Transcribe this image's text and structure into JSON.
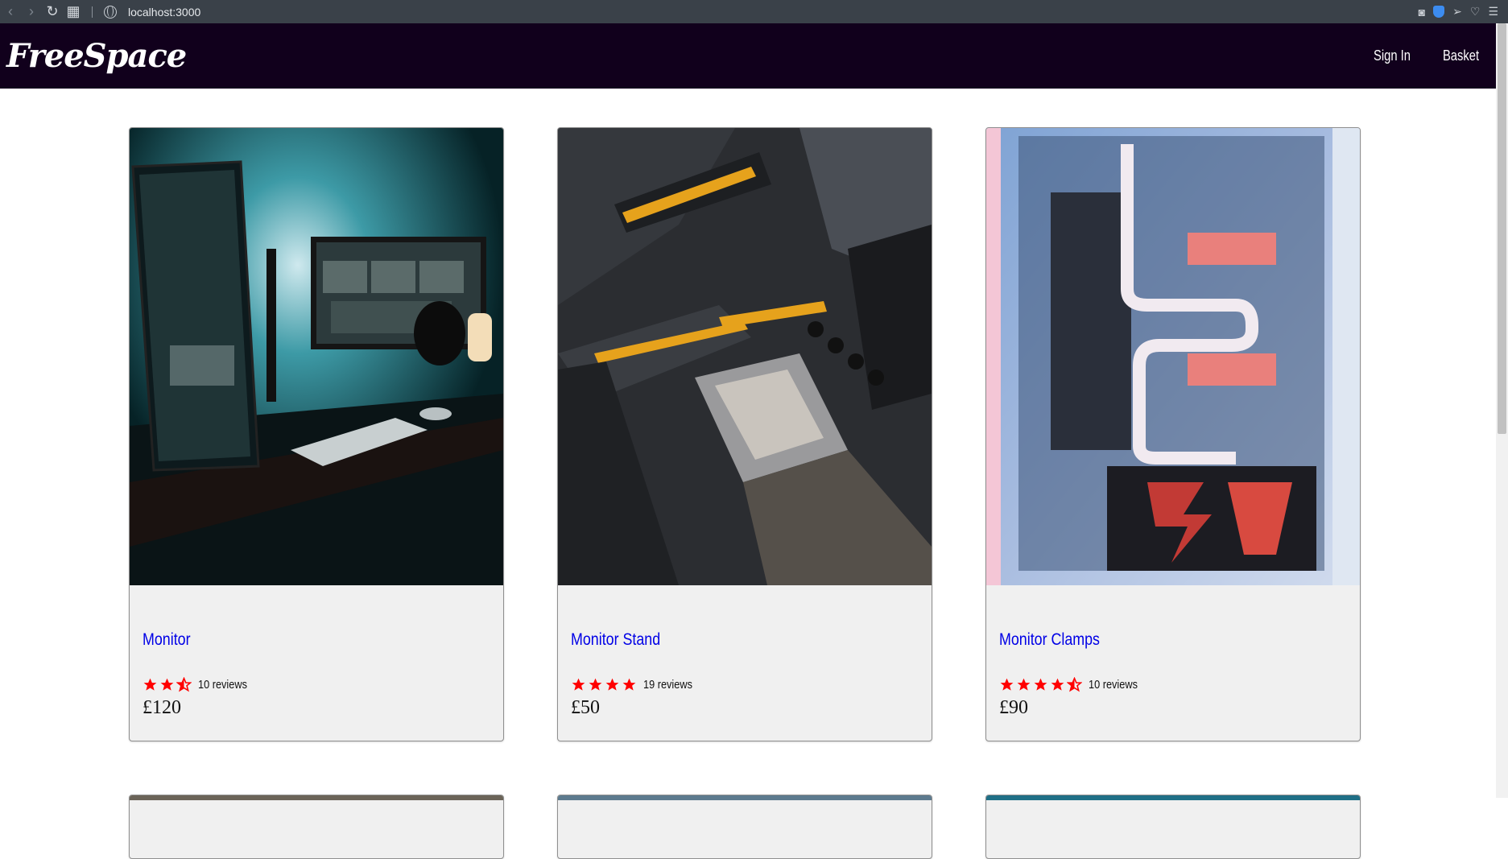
{
  "browser": {
    "url": "localhost:3000",
    "icons": [
      "back-icon",
      "forward-icon",
      "reload-icon",
      "tabs-grid-icon",
      "globe-icon",
      "camera-icon",
      "shield-icon",
      "send-icon",
      "heart-icon",
      "menu-icon"
    ]
  },
  "header": {
    "logo": "FreeSpace",
    "nav": [
      {
        "label": "Sign In"
      },
      {
        "label": "Basket"
      }
    ]
  },
  "products": [
    {
      "title": "Monitor",
      "rating": 2.5,
      "reviews": "10 reviews",
      "price": "£120",
      "image": "monitor-desk-photo"
    },
    {
      "title": "Monitor Stand",
      "rating": 4,
      "reviews": "19 reviews",
      "price": "£50",
      "image": "motherboard-photo"
    },
    {
      "title": "Monitor Clamps",
      "rating": 4.5,
      "reviews": "10 reviews",
      "price": "£90",
      "image": "pc-watercooling-photo"
    }
  ],
  "colors": {
    "header_bg": "#11001c",
    "link": "#0000e6",
    "star": "#ff0000",
    "card_bg": "#f0f0f0"
  }
}
